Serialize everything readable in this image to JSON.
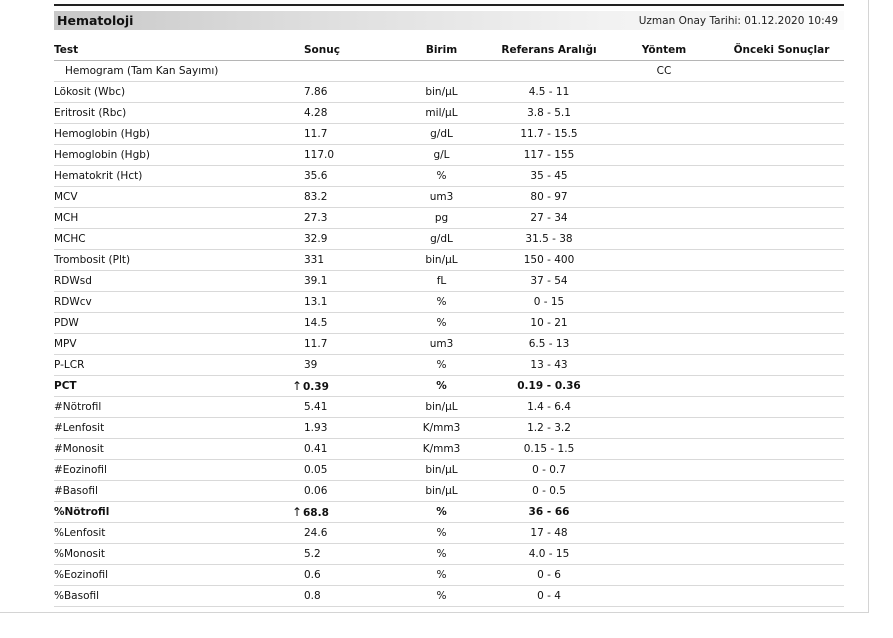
{
  "section": {
    "title": "Hematoloji",
    "approval_label": "Uzman Onay Tarihi:",
    "approval_value": "01.12.2020 10:49"
  },
  "columns": {
    "test": "Test",
    "result": "Sonuç",
    "unit": "Birim",
    "reference": "Referans Aralığı",
    "method": "Yöntem",
    "previous": "Önceki Sonuçlar"
  },
  "group": {
    "name": "Hemogram (Tam Kan Sayımı)",
    "method": "CC"
  },
  "rows": [
    {
      "test": "Lökosit (Wbc)",
      "result": "7.86",
      "unit": "bin/µL",
      "reference": "4.5 - 11",
      "flag": ""
    },
    {
      "test": "Eritrosit (Rbc)",
      "result": "4.28",
      "unit": "mil/µL",
      "reference": "3.8 - 5.1",
      "flag": ""
    },
    {
      "test": "Hemoglobin (Hgb)",
      "result": "11.7",
      "unit": "g/dL",
      "reference": "11.7 - 15.5",
      "flag": ""
    },
    {
      "test": "Hemoglobin (Hgb)",
      "result": "117.0",
      "unit": "g/L",
      "reference": "117 - 155",
      "flag": ""
    },
    {
      "test": "Hematokrit (Hct)",
      "result": "35.6",
      "unit": "%",
      "reference": "35 - 45",
      "flag": ""
    },
    {
      "test": "MCV",
      "result": "83.2",
      "unit": "um3",
      "reference": "80 - 97",
      "flag": ""
    },
    {
      "test": "MCH",
      "result": "27.3",
      "unit": "pg",
      "reference": "27 - 34",
      "flag": ""
    },
    {
      "test": "MCHC",
      "result": "32.9",
      "unit": "g/dL",
      "reference": "31.5 - 38",
      "flag": ""
    },
    {
      "test": "Trombosit (Plt)",
      "result": "331",
      "unit": "bin/µL",
      "reference": "150 - 400",
      "flag": ""
    },
    {
      "test": "RDWsd",
      "result": "39.1",
      "unit": "fL",
      "reference": "37 - 54",
      "flag": ""
    },
    {
      "test": "RDWcv",
      "result": "13.1",
      "unit": "%",
      "reference": "0 - 15",
      "flag": ""
    },
    {
      "test": "PDW",
      "result": "14.5",
      "unit": "%",
      "reference": "10 - 21",
      "flag": ""
    },
    {
      "test": "MPV",
      "result": "11.7",
      "unit": "um3",
      "reference": "6.5 - 13",
      "flag": ""
    },
    {
      "test": "P-LCR",
      "result": "39",
      "unit": "%",
      "reference": "13 - 43",
      "flag": ""
    },
    {
      "test": "PCT",
      "result": "0.39",
      "unit": "%",
      "reference": "0.19 - 0.36",
      "flag": "↑"
    },
    {
      "test": "#Nötrofil",
      "result": "5.41",
      "unit": "bin/µL",
      "reference": "1.4 - 6.4",
      "flag": ""
    },
    {
      "test": "#Lenfosit",
      "result": "1.93",
      "unit": "K/mm3",
      "reference": "1.2 - 3.2",
      "flag": ""
    },
    {
      "test": "#Monosit",
      "result": "0.41",
      "unit": "K/mm3",
      "reference": "0.15 - 1.5",
      "flag": ""
    },
    {
      "test": "#Eozinofil",
      "result": "0.05",
      "unit": "bin/µL",
      "reference": "0 - 0.7",
      "flag": ""
    },
    {
      "test": "#Basofil",
      "result": "0.06",
      "unit": "bin/µL",
      "reference": "0 - 0.5",
      "flag": ""
    },
    {
      "test": "%Nötrofil",
      "result": "68.8",
      "unit": "%",
      "reference": "36 - 66",
      "flag": "↑"
    },
    {
      "test": "%Lenfosit",
      "result": "24.6",
      "unit": "%",
      "reference": "17 - 48",
      "flag": ""
    },
    {
      "test": "%Monosit",
      "result": "5.2",
      "unit": "%",
      "reference": "4.0 - 15",
      "flag": ""
    },
    {
      "test": "%Eozinofil",
      "result": "0.6",
      "unit": "%",
      "reference": "0 - 6",
      "flag": ""
    },
    {
      "test": "%Basofil",
      "result": "0.8",
      "unit": "%",
      "reference": "0 - 4",
      "flag": ""
    }
  ]
}
